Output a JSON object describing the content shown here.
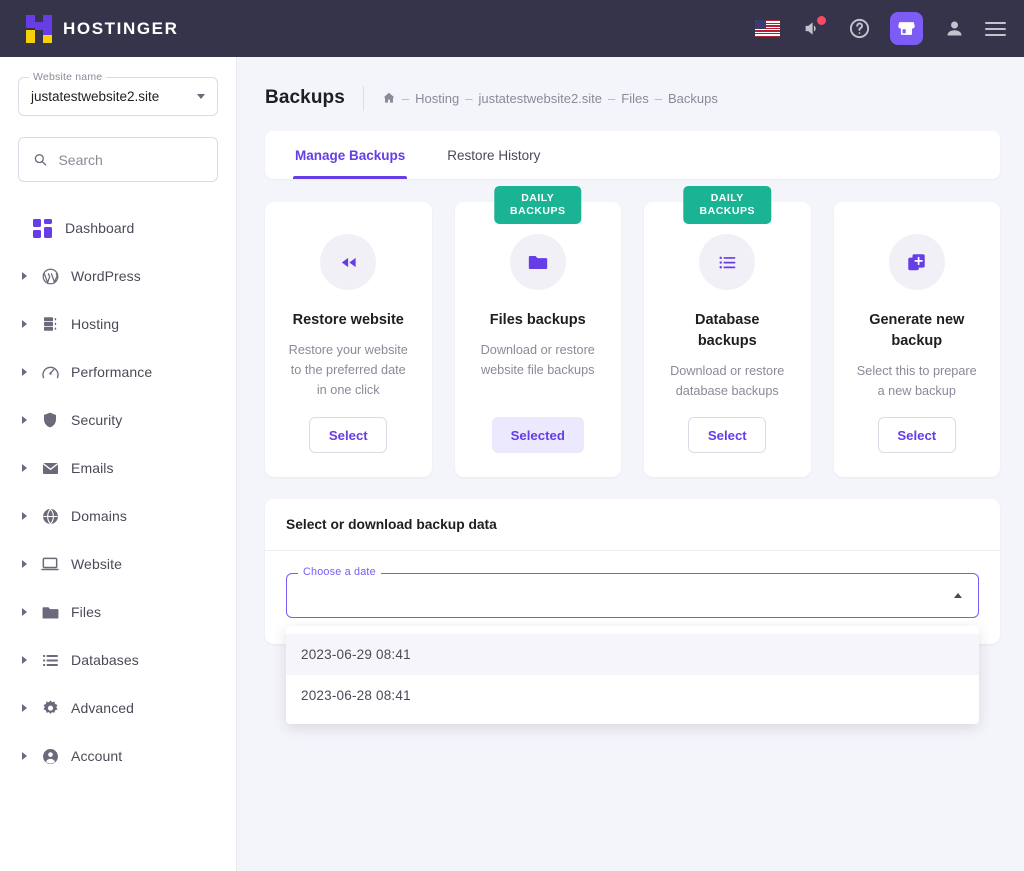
{
  "topbar": {
    "brand_name": "HOSTINGER",
    "icons": [
      {
        "name": "language-flag-icon",
        "label": "US"
      },
      {
        "name": "megaphone-icon",
        "label": "Announcements"
      },
      {
        "name": "help-icon",
        "label": "Help"
      },
      {
        "name": "store-icon",
        "label": "Store"
      },
      {
        "name": "account-icon",
        "label": "Account"
      },
      {
        "name": "menu-icon",
        "label": "Menu"
      }
    ],
    "accent": "#7c5cf5",
    "background": "#36344a",
    "notification_color": "#fa4b66"
  },
  "sidebar": {
    "site_selector": {
      "label": "Website name",
      "value": "justatestwebsite2.site"
    },
    "search": {
      "placeholder": "Search",
      "value": ""
    },
    "dashboard": {
      "label": "Dashboard"
    },
    "items": [
      {
        "label": "WordPress",
        "icon": "wordpress-icon"
      },
      {
        "label": "Hosting",
        "icon": "server-icon"
      },
      {
        "label": "Performance",
        "icon": "gauge-icon"
      },
      {
        "label": "Security",
        "icon": "shield-icon"
      },
      {
        "label": "Emails",
        "icon": "envelope-icon"
      },
      {
        "label": "Domains",
        "icon": "globe-icon"
      },
      {
        "label": "Website",
        "icon": "laptop-icon"
      },
      {
        "label": "Files",
        "icon": "folder-icon"
      },
      {
        "label": "Databases",
        "icon": "database-list-icon"
      },
      {
        "label": "Advanced",
        "icon": "gear-icon"
      },
      {
        "label": "Account",
        "icon": "person-circle-icon"
      }
    ]
  },
  "page": {
    "title": "Backups",
    "breadcrumb": [
      "Hosting",
      "justatestwebsite2.site",
      "Files",
      "Backups"
    ],
    "breadcrumb_separator": "–"
  },
  "tabs": [
    {
      "label": "Manage Backups",
      "active": true
    },
    {
      "label": "Restore History",
      "active": false
    }
  ],
  "cards": [
    {
      "title": "Restore website",
      "desc": "Restore your website to the preferred date in one click",
      "button": "Select",
      "selected": false,
      "badge": null,
      "icon": "rewind-icon"
    },
    {
      "title": "Files backups",
      "desc": "Download or restore website file backups",
      "button": "Selected",
      "selected": true,
      "badge": "DAILY\nBACKUPS",
      "icon": "folder-icon"
    },
    {
      "title": "Database backups",
      "desc": "Download or restore database backups",
      "button": "Select",
      "selected": false,
      "badge": "DAILY\nBACKUPS",
      "icon": "list-icon"
    },
    {
      "title": "Generate new backup",
      "desc": "Select this to prepare a new backup",
      "button": "Select",
      "selected": false,
      "badge": null,
      "icon": "duplicate-plus-icon"
    }
  ],
  "panel": {
    "title": "Select or download backup data",
    "date_field": {
      "label": "Choose a date",
      "value": "",
      "expanded": true
    },
    "options": [
      {
        "label": "2023-06-29 08:41",
        "hovered": true
      },
      {
        "label": "2023-06-28 08:41",
        "hovered": false
      }
    ]
  },
  "colors": {
    "purple": "#673de6",
    "green_badge": "#1ab394",
    "page_bg": "#f4f4fb"
  }
}
